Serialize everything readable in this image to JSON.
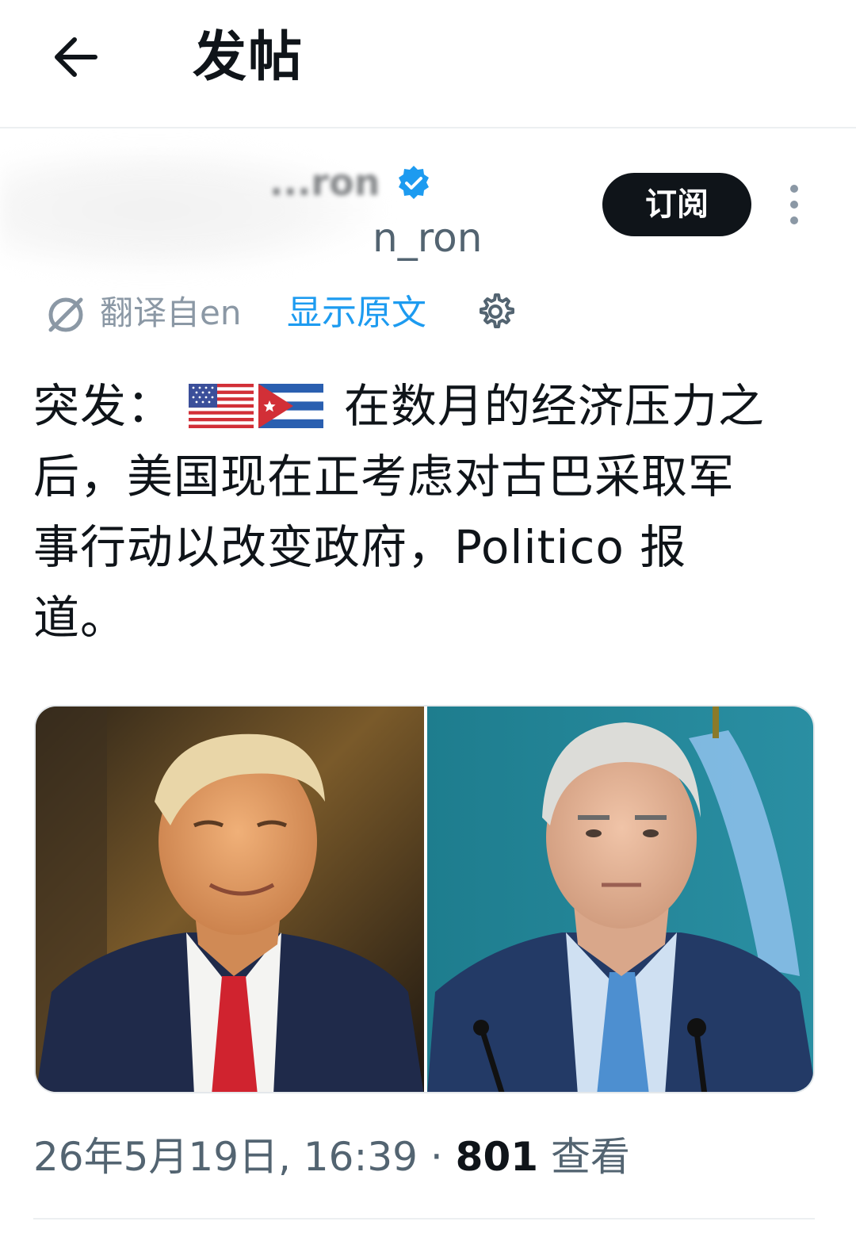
{
  "header": {
    "title": "发帖"
  },
  "author": {
    "display_name": "...ron",
    "handle": "@..._ron",
    "handle_visible": "n_ron",
    "follow_label": "订阅"
  },
  "translation": {
    "label": "翻译自en",
    "show_original_label": "显示原文"
  },
  "post": {
    "text_prefix": "突发：",
    "text_body": "在数月的经济压力之后，美国现在正考虑对古巴采取军事行动以改变政府，Politico 报道。",
    "flags": [
      "us-flag-emoji",
      "cuba-flag-emoji"
    ]
  },
  "media": {
    "images": [
      "portrait-left",
      "portrait-right"
    ]
  },
  "meta": {
    "timestamp": "26年5月19日, 16:39",
    "separator": "·",
    "views_count": "801",
    "views_label": "查看"
  },
  "colors": {
    "accent": "#1d9bf0",
    "text_primary": "#0f1419",
    "text_secondary": "#536471",
    "button_bg": "#0f1419"
  }
}
